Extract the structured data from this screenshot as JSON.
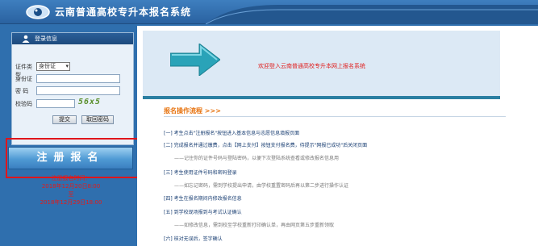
{
  "header": {
    "title": "云南普通高校专升本报名系统",
    "logo_icon": "eye-logo-icon",
    "bg_color": "#2f6fae"
  },
  "login": {
    "heading": "登录信息",
    "cert_type_label": "证件类型",
    "cert_type_value": "身份证",
    "id_label": "身份证",
    "password_label": "密  码",
    "captcha_label": "校验码",
    "captcha_value": "56x5",
    "submit_label": "提交",
    "retrieve_label": "取回密码"
  },
  "register": {
    "button_label": "注册报名",
    "time_lines": [
      "注册报名时间：",
      "2018年12月20日8:00",
      "至",
      "2018年12月29日18:00"
    ],
    "highlight_color": "#e0151b"
  },
  "main": {
    "welcome": "欢迎登入云南普通高校专升本网上报名系统",
    "section_title": "报名操作流程 >>>",
    "steps": [
      "[一] 考生点击\"注册报名\"按钮进入基本信息与志愿信息填报页面",
      "[二] 完成报名并通过缴费，点击【网上支付】按钮支付报名费，待提示\"网报已成功\"后关闭页面",
      "——记住你的证件号码与登陆密码，以便下次登陆系统查看或修改报名信息用",
      "[三] 考生使用证件号码和密码登录",
      "——如忘记密码，需到学校提出申请，由学校重置密码后再以第二步进行操作认证",
      "[四] 考生在报名期间内修改报名信息",
      "[五] 到学校现场报到与考试认证确认",
      "——如修改信息，需到校至学校重新打印确认单，再由网页第五步重新领取",
      "[六] 核对无误后，签字确认"
    ]
  }
}
